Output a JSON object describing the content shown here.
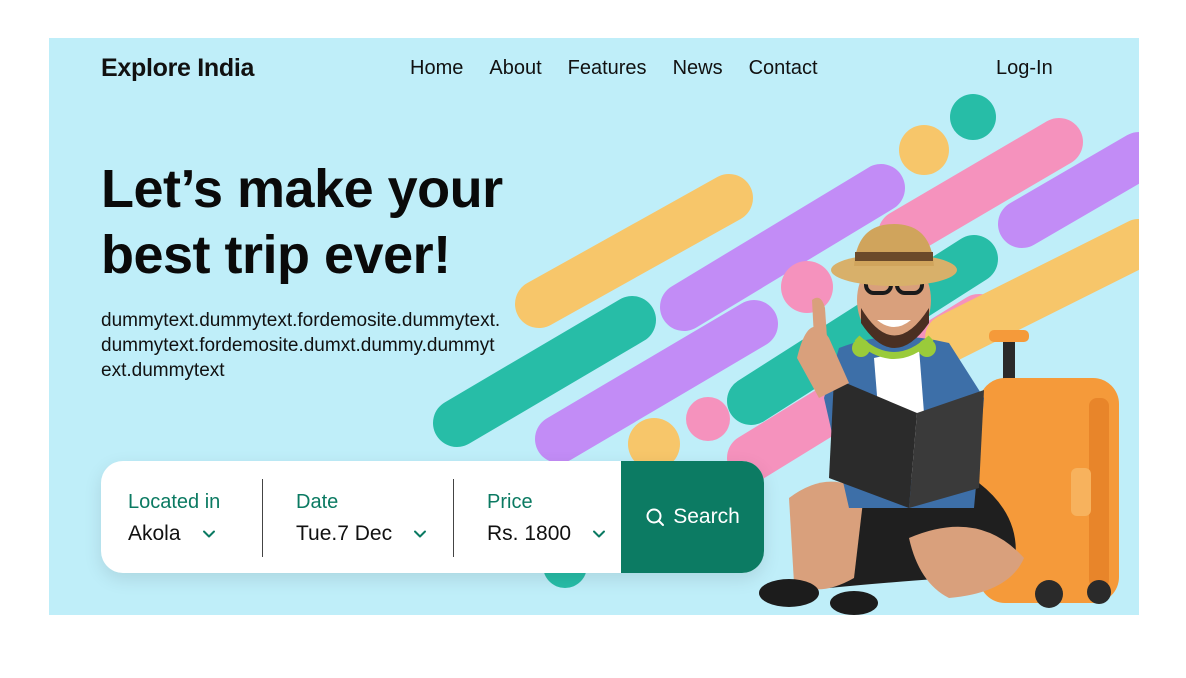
{
  "header": {
    "brand": "Explore India",
    "nav": [
      "Home",
      "About",
      "Features",
      "News",
      "Contact"
    ],
    "login": "Log-In"
  },
  "hero": {
    "headline_line1": "Let’s make your",
    "headline_line2": "best trip ever!",
    "description": "dummytext.dummytext.fordemosite.dummytext.dummytext.fordemosite.dumxt.dummy.dummytext.dummytext"
  },
  "search": {
    "location": {
      "label": "Located in",
      "value": "Akola"
    },
    "date": {
      "label": "Date",
      "value": "Tue.7 Dec"
    },
    "price": {
      "label": "Price",
      "value": "Rs. 1800"
    },
    "button_label": "Search"
  },
  "colors": {
    "background": "#bfeef9",
    "accent": "#0c7b63",
    "stripe_yellow": "#f7c66a",
    "stripe_purple": "#c28cf6",
    "stripe_teal": "#27bda7",
    "stripe_pink": "#f592bd",
    "suitcase": "#f59a3a"
  },
  "icons": [
    "chevron-down-icon",
    "search-icon"
  ]
}
